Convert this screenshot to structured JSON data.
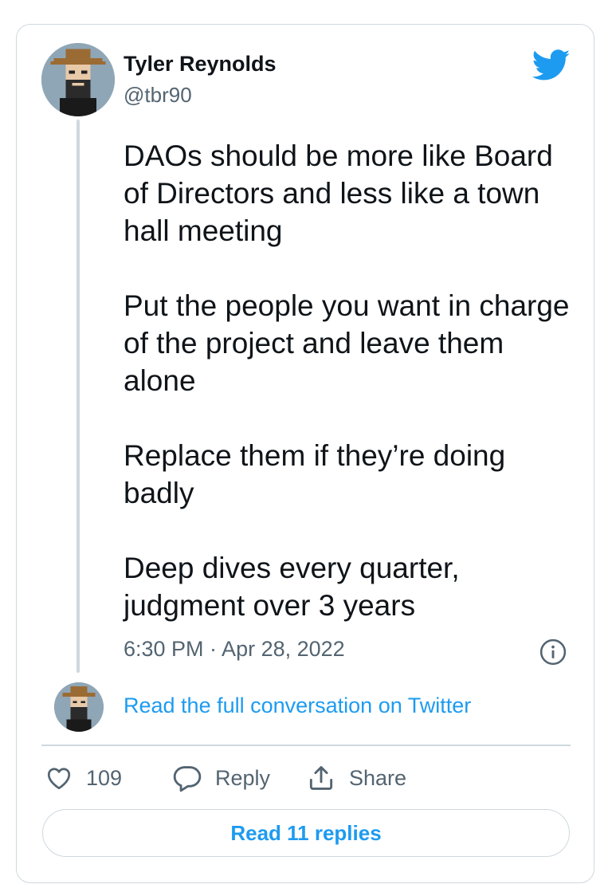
{
  "tweet": {
    "author": {
      "display_name": "Tyler Reynolds",
      "handle": "@tbr90",
      "avatar_icon": "pixel-cowboy-avatar-icon"
    },
    "paragraphs": [
      "DAOs should be more like Board of Directors and less like a town hall meeting",
      "Put the people you want in charge of the project and leave them alone",
      "Replace them if they’re doing badly",
      "Deep dives every quarter, judgment over 3 years"
    ],
    "timestamp": "6:30 PM · Apr 28, 2022",
    "conversation_link": "Read the full conversation on Twitter",
    "actions": {
      "likes": "109",
      "reply_label": "Reply",
      "share_label": "Share"
    },
    "read_replies_label": "Read 11 replies"
  },
  "colors": {
    "accent": "#1d9bf0",
    "text": "#0f1419",
    "muted": "#536471",
    "border": "#cfd9de"
  },
  "icons": {
    "brand": "twitter-bird-icon",
    "info": "info-icon",
    "like": "heart-icon",
    "reply": "reply-bubble-icon",
    "share": "share-upload-icon"
  }
}
